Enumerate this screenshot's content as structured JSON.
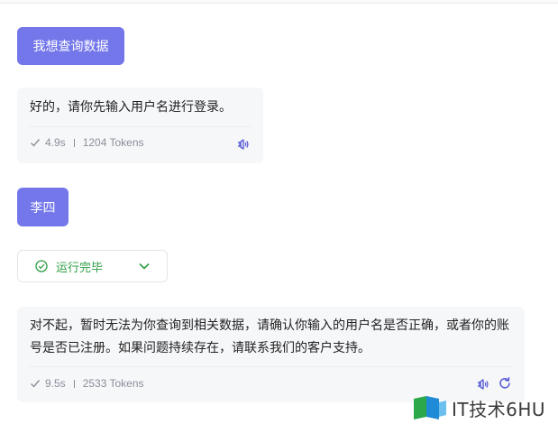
{
  "conversation": {
    "user_message_1": "我想查询数据",
    "assistant_message_1": {
      "text": "好的，请你先输入用户名进行登录。",
      "time": "4.9s",
      "tokens": "1204 Tokens"
    },
    "user_message_2": "李四",
    "run_status": "运行完毕",
    "assistant_message_2": {
      "text": "对不起，暂时无法为你查询到相关数据，请确认你输入的用户名是否正确，或者你的账号是否已注册。如果问题持续存在，请联系我们的客户支持。",
      "time": "9.5s",
      "tokens": "2533 Tokens"
    }
  },
  "watermark": {
    "text": "IT技术6HU"
  },
  "colors": {
    "user_bubble": "#7377ea",
    "assistant_card": "#f6f7f9",
    "status_green": "#2f9e44",
    "icon_purple": "#5b5fd6"
  },
  "icons": [
    "check-icon",
    "speaker-icon",
    "refresh-icon",
    "check-circle-icon",
    "chevron-down-icon"
  ]
}
